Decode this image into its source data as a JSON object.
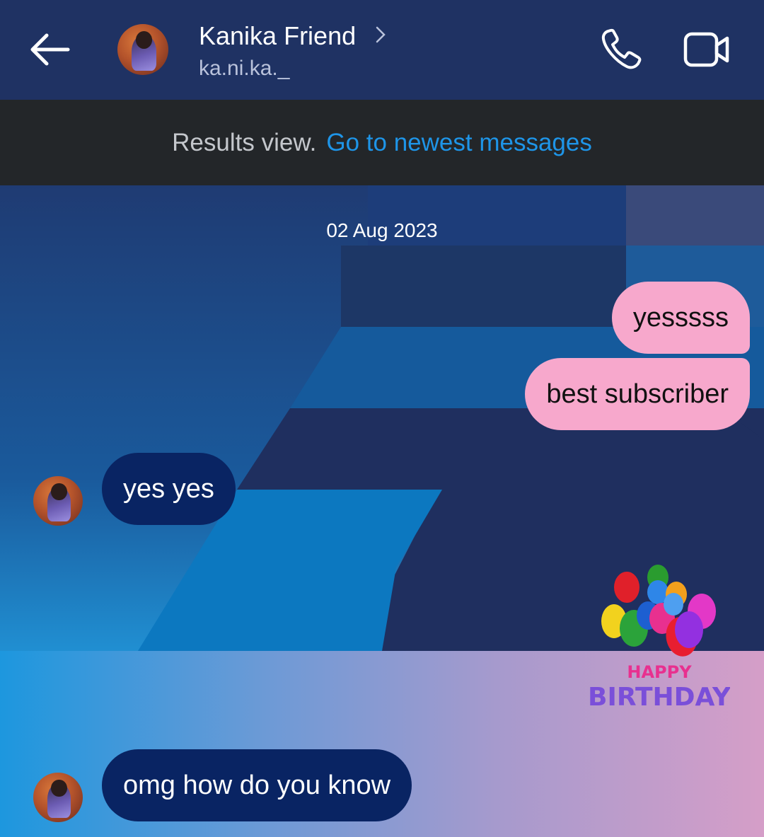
{
  "header": {
    "contact_name": "Kanika Friend",
    "username": "ka.ni.ka._",
    "icons": [
      "back-arrow-icon",
      "chevron-right-icon",
      "phone-icon",
      "video-camera-icon"
    ]
  },
  "banner": {
    "label": "Results view.",
    "link": "Go to newest messages"
  },
  "conversation": {
    "date": "02 Aug 2023",
    "messages": [
      {
        "from": "me",
        "text": "yesssss"
      },
      {
        "from": "me",
        "text": "best subscriber"
      },
      {
        "from": "contact",
        "text": "yes yes"
      },
      {
        "from": "me",
        "sticker": "balloons",
        "sticker_text": "HAPPY BIRTHDAY"
      },
      {
        "from": "contact",
        "text": "omg how do you know"
      }
    ]
  },
  "colors": {
    "header_bg": "#1f3263",
    "banner_bg": "#232629",
    "link": "#1e95e8",
    "outgoing_bubble": "#f7a8cc",
    "incoming_bubble": "#092463"
  }
}
